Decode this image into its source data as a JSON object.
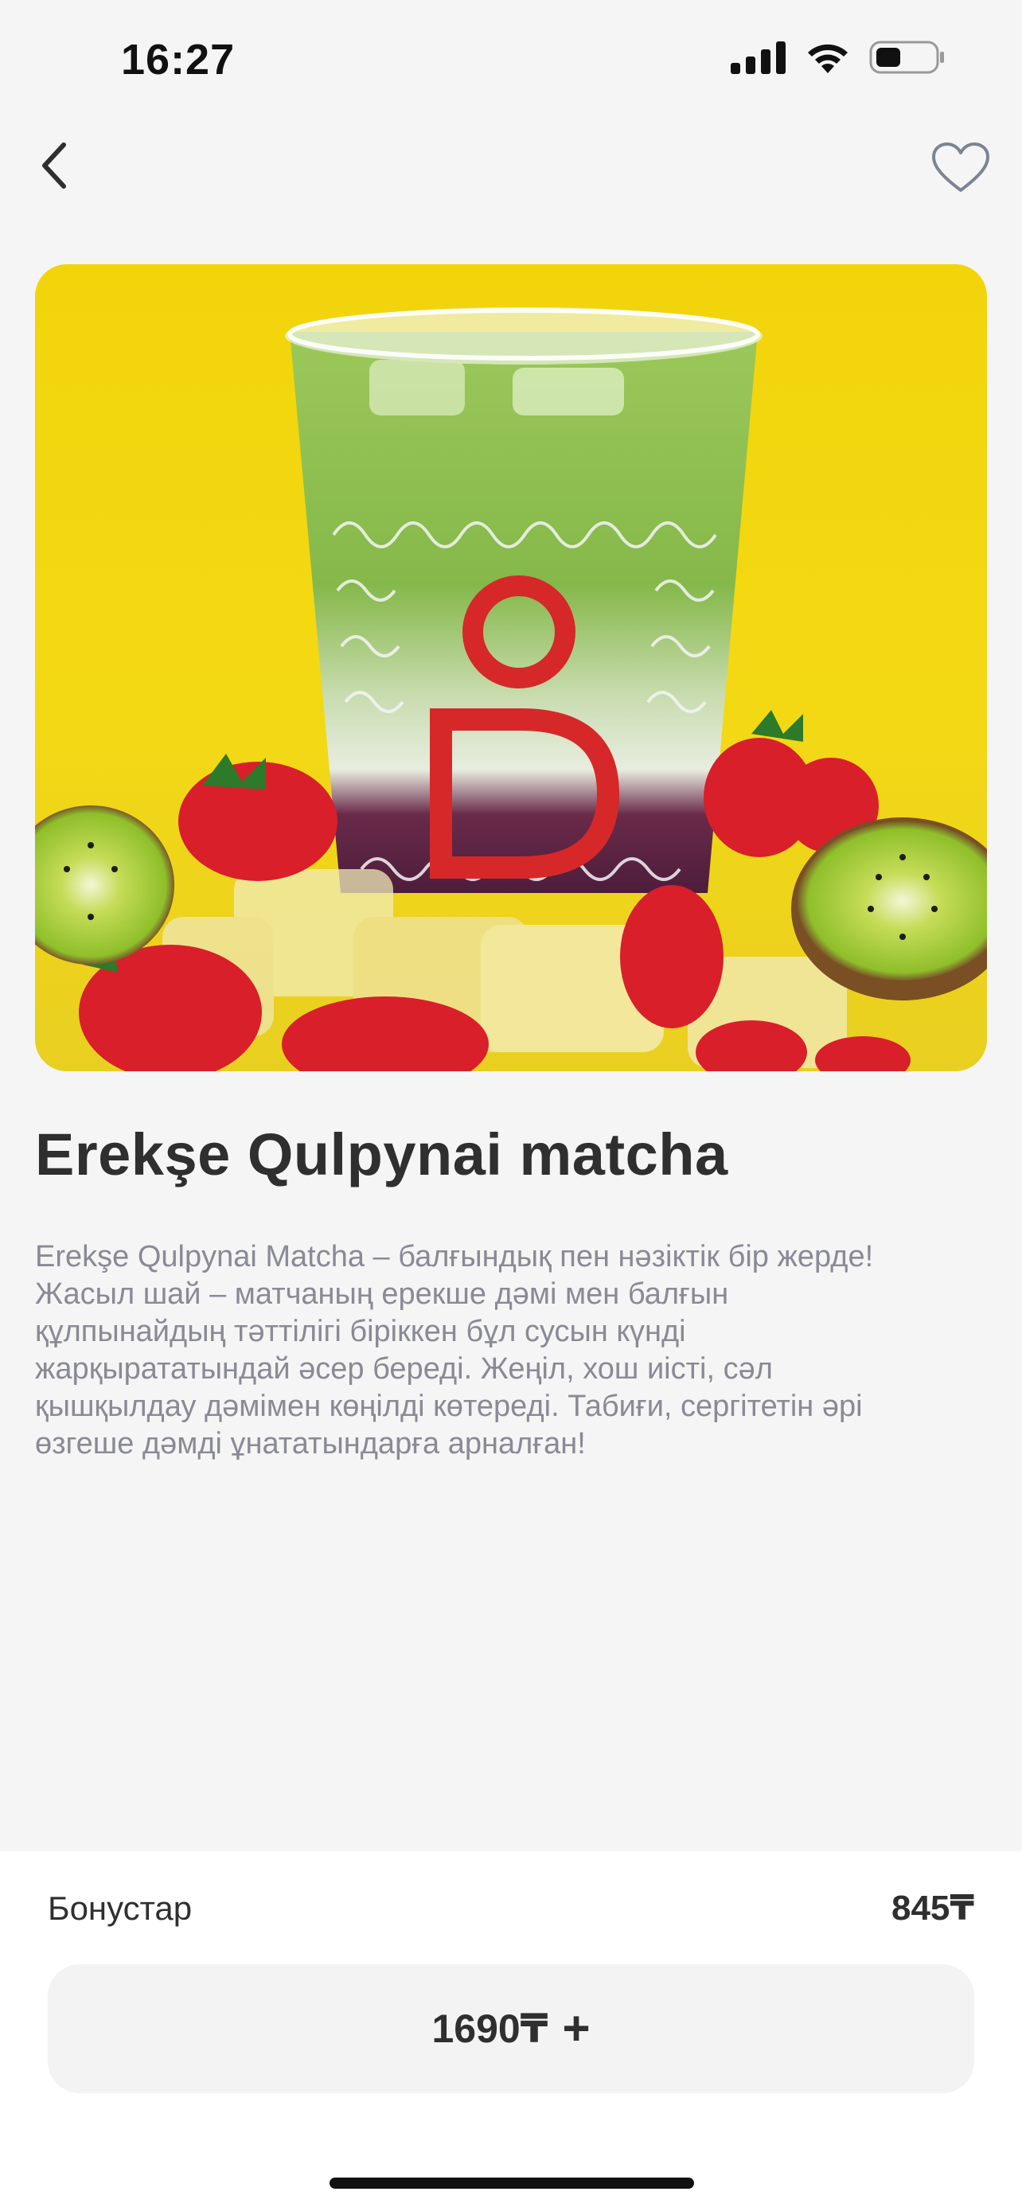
{
  "status_bar": {
    "time": "16:27",
    "icons": [
      "cellular-signal-icon",
      "wifi-icon",
      "battery-icon"
    ]
  },
  "nav": {
    "back_icon": "chevron-left-icon",
    "favorite_icon": "heart-outline-icon"
  },
  "product": {
    "image_description_icon": "product-photo",
    "title": "Erekşe Qulpynai matcha",
    "description_lines": [
      "Erekşe Qulpynai Matcha – балғындық пен нәзіктік бір жерде!",
      "Жасыл шай – матчаның ерекше дәмі мен балғын",
      "құлпынайдың тәттілігі біріккен бұл сусын күнді",
      "жарқырататындай әсер береді. Жеңіл, хош иісті, сәл",
      "қышқылдау дәмімен көңілді көтереді. Табиғи, сергітетін әрі",
      "өзгеше дәмді ұнататындарға арналған!"
    ]
  },
  "bottom": {
    "bonus_label": "Бонустар",
    "bonus_value": "845₸",
    "price_label": "1690₸",
    "plus_icon": "plus-icon",
    "plus_text": "+"
  },
  "colors": {
    "background": "#f5f5f5",
    "hero_yellow": "#f2d40b",
    "matcha_green": "#8fbf3f",
    "logo_red": "#d62828",
    "text_dark": "#2f2f2f",
    "text_muted": "#8a8a96",
    "button_bg": "#f3f3f4"
  }
}
